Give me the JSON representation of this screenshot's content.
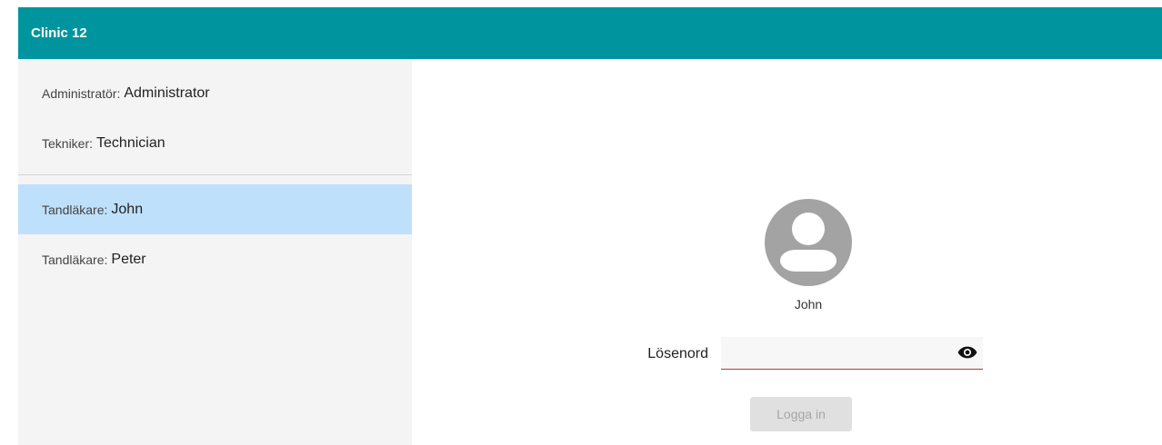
{
  "appbar": {
    "title": "Clinic 12"
  },
  "sidebar": {
    "items": [
      {
        "role": "Administratör:",
        "name": "Administrator",
        "selected": false
      },
      {
        "role": "Tekniker:",
        "name": "Technician",
        "selected": false
      },
      {
        "role": "Tandläkare:",
        "name": "John",
        "selected": true
      },
      {
        "role": "Tandläkare:",
        "name": "Peter",
        "selected": false
      }
    ]
  },
  "login": {
    "avatar_icon": "account-circle-icon",
    "user_name": "John",
    "password_label": "Lösenord",
    "password_value": "",
    "visibility_icon": "eye-icon",
    "button_label": "Logga in",
    "button_enabled": false
  },
  "colors": {
    "appbar": "#00959e",
    "selected_item": "#bfe0fb",
    "sidebar_bg": "#f4f4f4",
    "field_underline": "#c0392b"
  }
}
